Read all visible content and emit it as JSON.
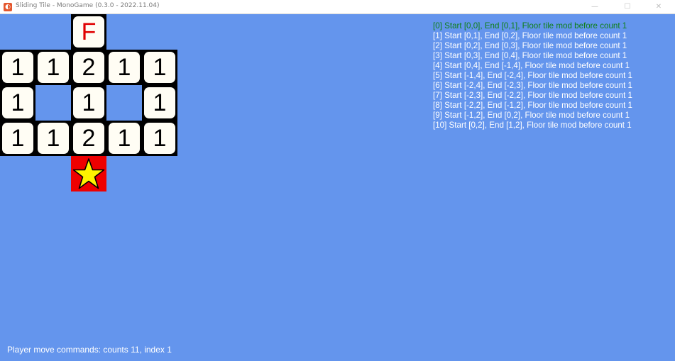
{
  "window": {
    "title": "Sliding Tile - MonoGame (0.3.0 - 2022.11.04)",
    "min_glyph": "—",
    "max_glyph": "☐",
    "close_glyph": "✕",
    "app_icon": "monogame-logo-icon"
  },
  "board": {
    "finish_label": "F",
    "tiles": [
      "1",
      "1",
      "2",
      "1",
      "1",
      "1",
      "1",
      "1",
      "1",
      "1",
      "2",
      "1",
      "1"
    ],
    "goal_icon": "star-icon",
    "colors": {
      "background": "#6495ED",
      "wall": "#000000",
      "tile": "#FFFDF4",
      "finish_text": "#E00000",
      "goal_cell": "#EE0000",
      "star": "#FFF200"
    }
  },
  "log": {
    "lines": [
      "[0] Start [0,0], End [0,1], Floor tile mod before count 1",
      "[1] Start [0,1], End [0,2], Floor tile mod before count 1",
      "[2] Start [0,2], End [0,3], Floor tile mod before count 1",
      "[3] Start [0,3], End [0,4], Floor tile mod before count 1",
      "[4] Start [0,4], End [-1,4], Floor tile mod before count 1",
      "[5] Start [-1,4], End [-2,4], Floor tile mod before count 1",
      "[6] Start [-2,4], End [-2,3], Floor tile mod before count 1",
      "[7] Start [-2,3], End [-2,2], Floor tile mod before count 1",
      "[8] Start [-2,2], End [-1,2], Floor tile mod before count 1",
      "[9] Start [-1,2], End [0,2], Floor tile mod before count 1",
      "[10] Start [0,2], End [1,2], Floor tile mod before count 1"
    ],
    "active_color": "#0E7F16"
  },
  "status": {
    "text": "Player move commands: counts 11, index 1"
  }
}
